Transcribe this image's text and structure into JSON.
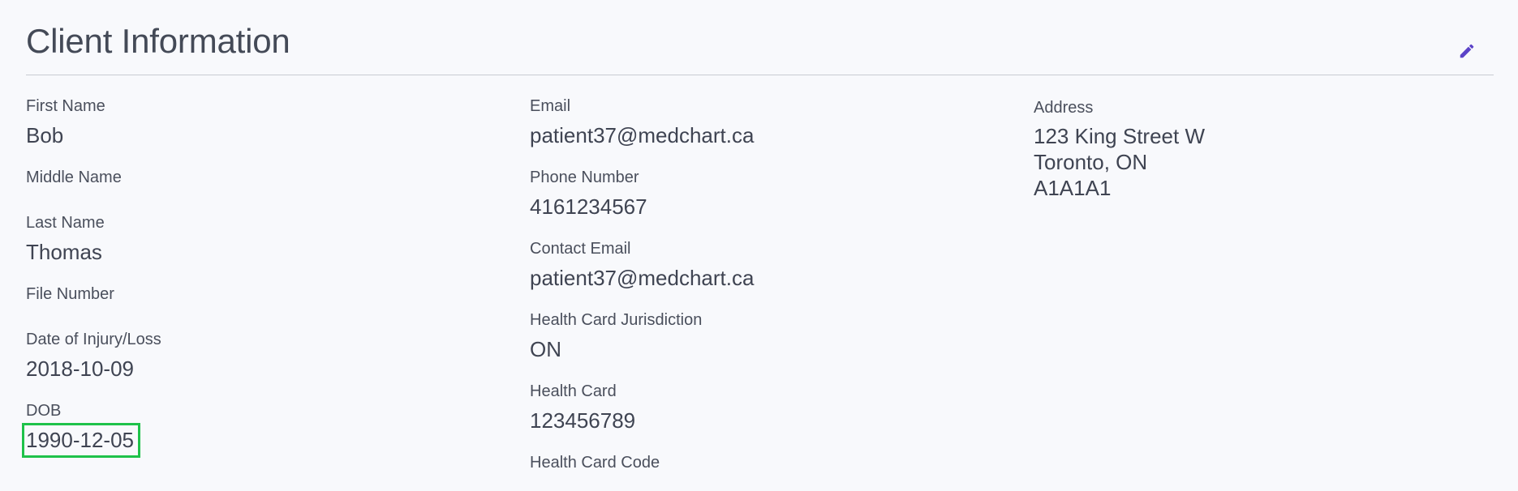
{
  "header": {
    "title": "Client Information",
    "edit_icon": "pencil-icon",
    "accent_color": "#5b43c8"
  },
  "highlight_color": "#1fc24a",
  "column1": {
    "first_name": {
      "label": "First Name",
      "value": "Bob"
    },
    "middle_name": {
      "label": "Middle Name",
      "value": ""
    },
    "last_name": {
      "label": "Last Name",
      "value": "Thomas"
    },
    "file_number": {
      "label": "File Number",
      "value": ""
    },
    "date_of_injury": {
      "label": "Date of Injury/Loss",
      "value": "2018-10-09"
    },
    "dob": {
      "label": "DOB",
      "value": "1990-12-05"
    }
  },
  "column2": {
    "email": {
      "label": "Email",
      "value": "patient37@medchart.ca"
    },
    "phone": {
      "label": "Phone Number",
      "value": "4161234567"
    },
    "contact_email": {
      "label": "Contact Email",
      "value": "patient37@medchart.ca"
    },
    "health_card_jurisdiction": {
      "label": "Health Card Jurisdiction",
      "value": "ON"
    },
    "health_card": {
      "label": "Health Card",
      "value": "123456789"
    },
    "health_card_code": {
      "label": "Health Card Code",
      "value": ""
    }
  },
  "column3": {
    "address": {
      "label": "Address",
      "lines": [
        "123 King Street W",
        "Toronto, ON",
        "A1A1A1"
      ]
    }
  }
}
